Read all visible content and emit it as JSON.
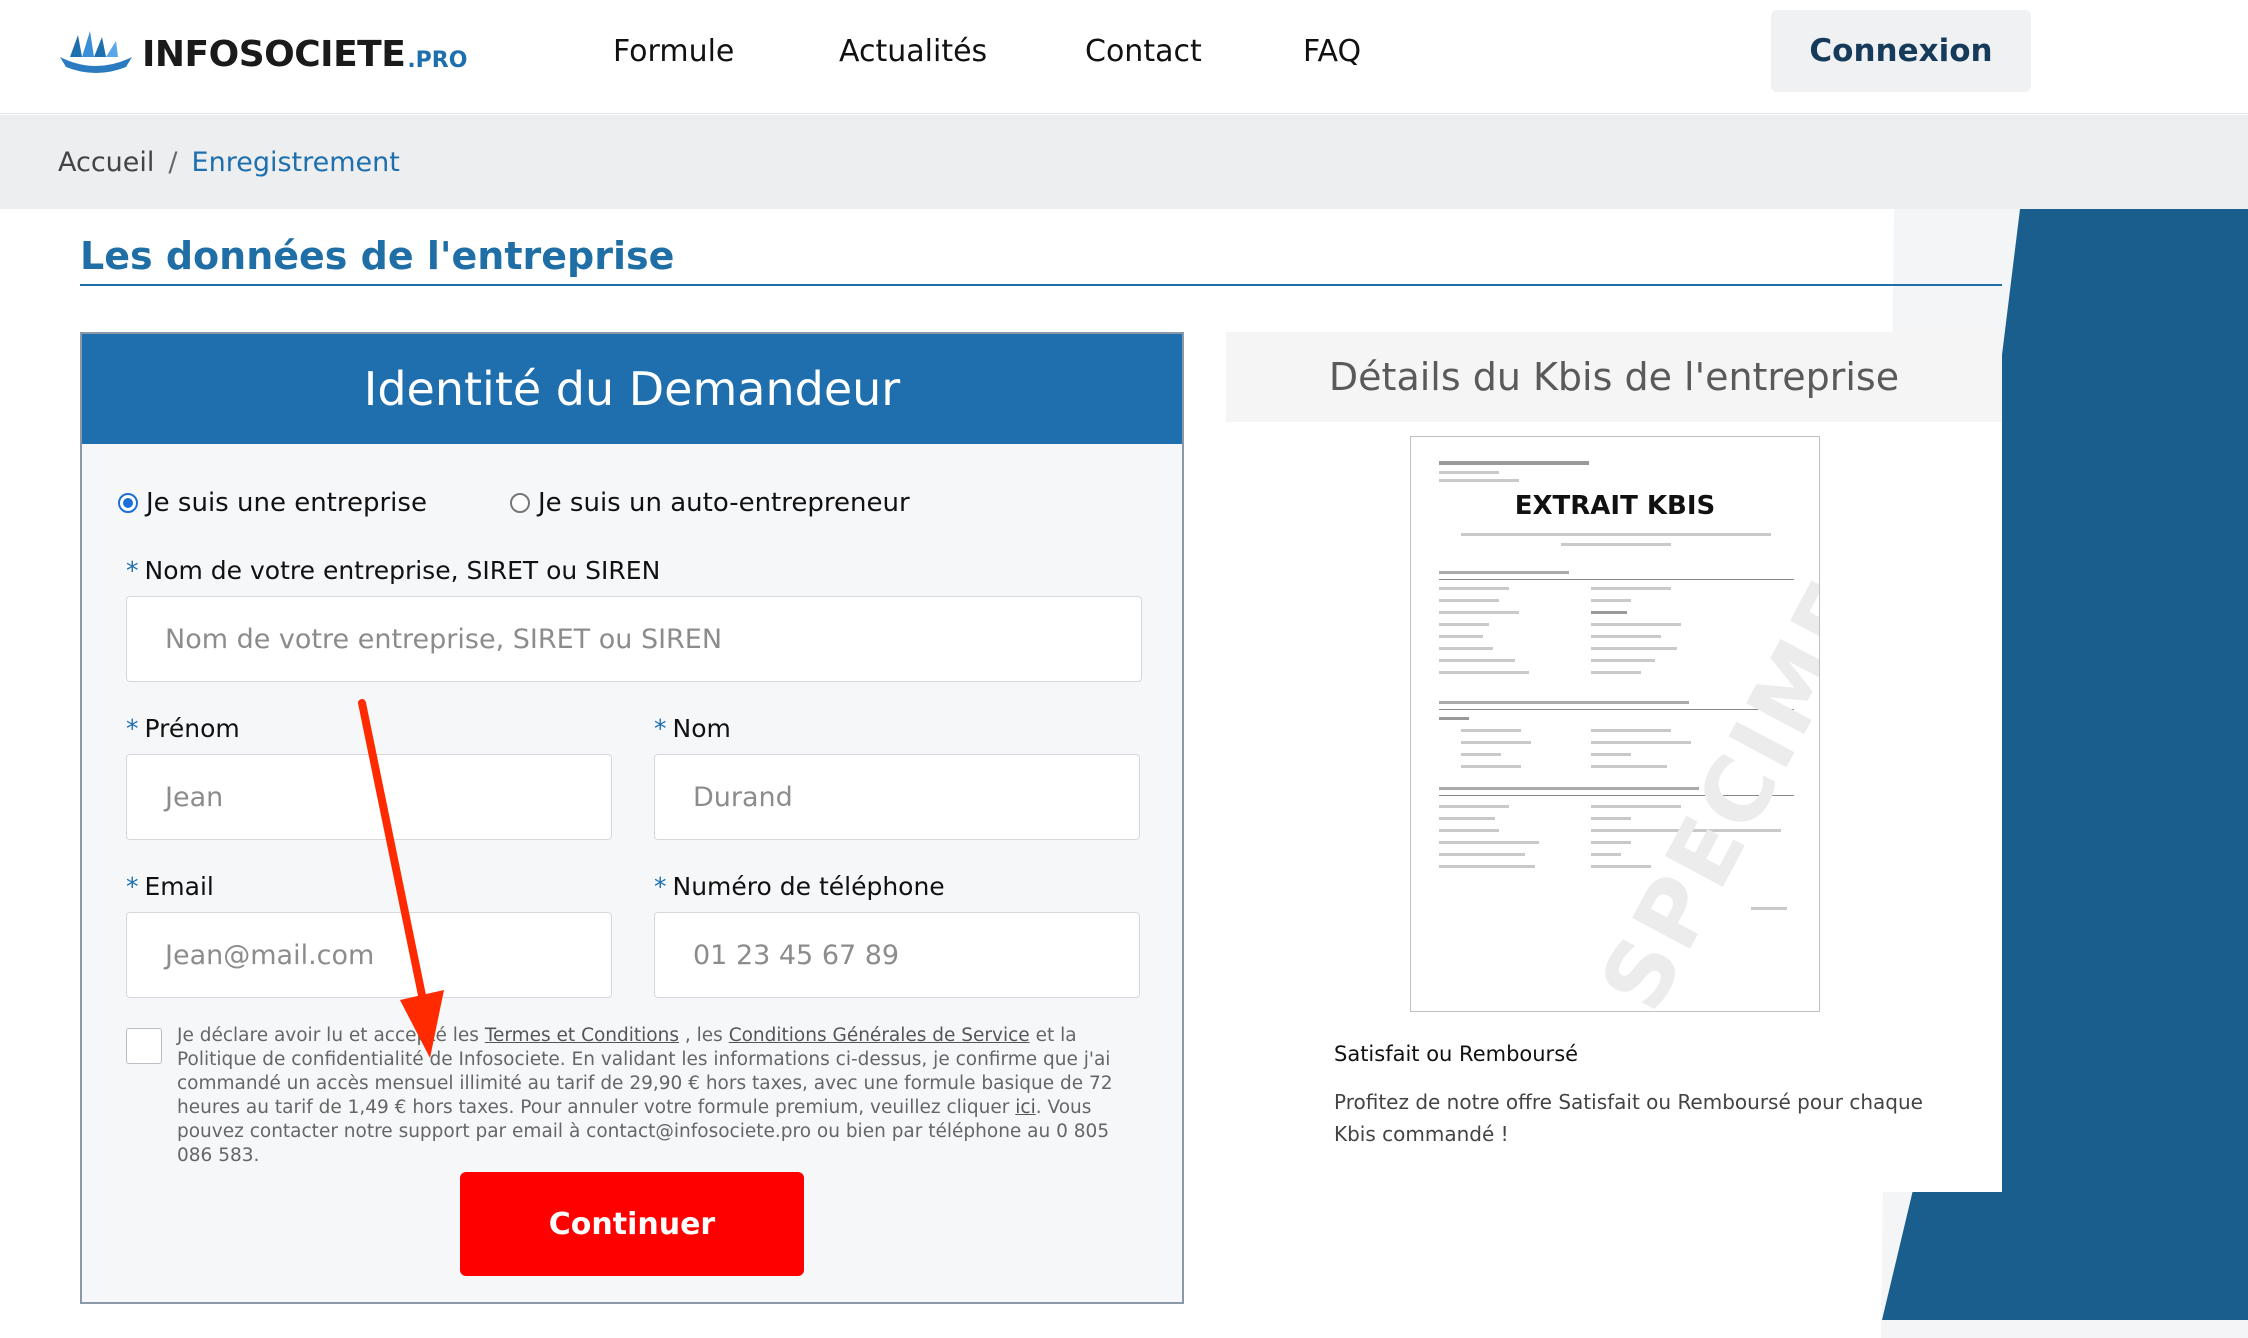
{
  "header": {
    "logo_text": "INFOSOCIETE",
    "logo_suffix": ".PRO",
    "nav": [
      "Formule",
      "Actualités",
      "Contact",
      "FAQ"
    ],
    "login_label": "Connexion"
  },
  "breadcrumb": {
    "home": "Accueil",
    "separator": "/",
    "current": "Enregistrement"
  },
  "section_title": "Les données de l'entreprise",
  "form": {
    "title": "Identité du Demandeur",
    "radio_company": "Je suis une entreprise",
    "radio_auto": "Je suis un auto-entrepreneur",
    "required_mark": "*",
    "company_label": "Nom de votre entreprise, SIRET ou SIREN",
    "company_placeholder": "Nom de votre entreprise, SIRET ou SIREN",
    "firstname_label": "Prénom",
    "firstname_placeholder": "Jean",
    "lastname_label": "Nom",
    "lastname_placeholder": "Durand",
    "email_label": "Email",
    "email_placeholder": "Jean@mail.com",
    "phone_label": "Numéro de téléphone",
    "phone_placeholder": "01 23 45 67 89",
    "legal_part1": "Je déclare avoir lu et accepté les ",
    "legal_link1": "Termes et Conditions",
    "legal_part2": " , les ",
    "legal_link2": "Conditions Générales de Service",
    "legal_part3": " et la Politique de confidentialité de Infosociete. En validant les informations ci-dessus, je confirme que j'ai commandé un accès mensuel illimité au tarif de 29,90 € hors taxes, avec une formule basique de 72 heures au tarif de 1,49 € hors taxes. Pour annuler votre formule premium, veuillez cliquer ",
    "legal_link3": "ici",
    "legal_part4": ". Vous pouvez contacter notre support par email à contact@infosociete.pro ou bien par téléphone au 0 805 086 583.",
    "continue_label": "Continuer"
  },
  "details": {
    "title": "Détails du Kbis de l'entreprise",
    "kbis_title": "EXTRAIT KBIS",
    "kbis_watermark": "SPECIMEN",
    "guarantee_title": "Satisfait ou Remboursé",
    "guarantee_text": "Profitez de notre offre Satisfait ou Remboursé pour chaque Kbis commandé !"
  },
  "colors": {
    "brand_blue": "#1f6fae",
    "cta_red": "#ff0000",
    "annotation_arrow": "#ff2a00"
  }
}
